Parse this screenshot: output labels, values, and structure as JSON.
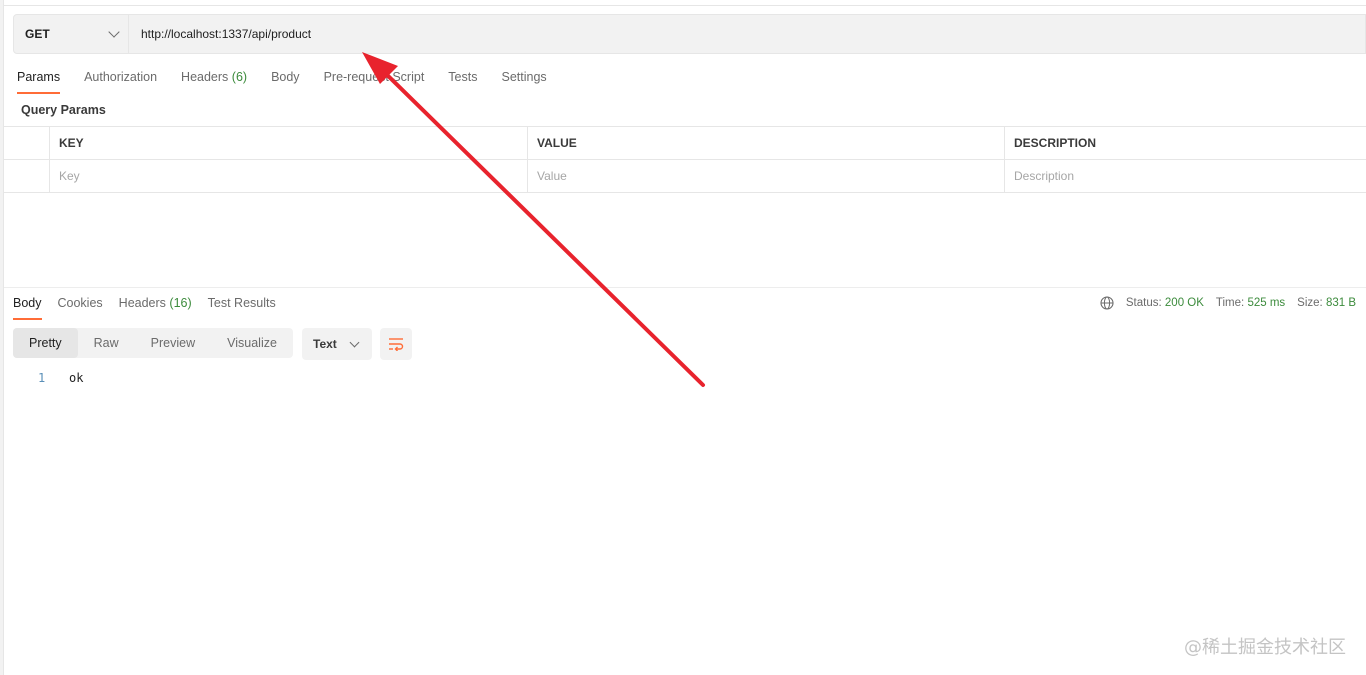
{
  "request": {
    "method": "GET",
    "url": "http://localhost:1337/api/product"
  },
  "request_tabs": {
    "params": "Params",
    "authorization": "Authorization",
    "headers": "Headers",
    "headers_count": "(6)",
    "body": "Body",
    "prerequest": "Pre-request Script",
    "tests": "Tests",
    "settings": "Settings"
  },
  "query_params": {
    "title": "Query Params",
    "columns": [
      "KEY",
      "VALUE",
      "DESCRIPTION"
    ],
    "placeholders": [
      "Key",
      "Value",
      "Description"
    ]
  },
  "response_tabs": {
    "body": "Body",
    "cookies": "Cookies",
    "headers": "Headers",
    "headers_count": "(16)",
    "test_results": "Test Results"
  },
  "status": {
    "status_label": "Status:",
    "status_value": "200 OK",
    "time_label": "Time:",
    "time_value": "525 ms",
    "size_label": "Size:",
    "size_value": "831 B"
  },
  "view_modes": [
    "Pretty",
    "Raw",
    "Preview",
    "Visualize"
  ],
  "format": "Text",
  "response_body": {
    "line_number": "1",
    "content": "ok"
  },
  "watermark": "@稀土掘金技术社区",
  "colors": {
    "accent": "#ff6c37",
    "status_green": "#3c8b3c",
    "annotation_arrow": "#e8232d"
  }
}
